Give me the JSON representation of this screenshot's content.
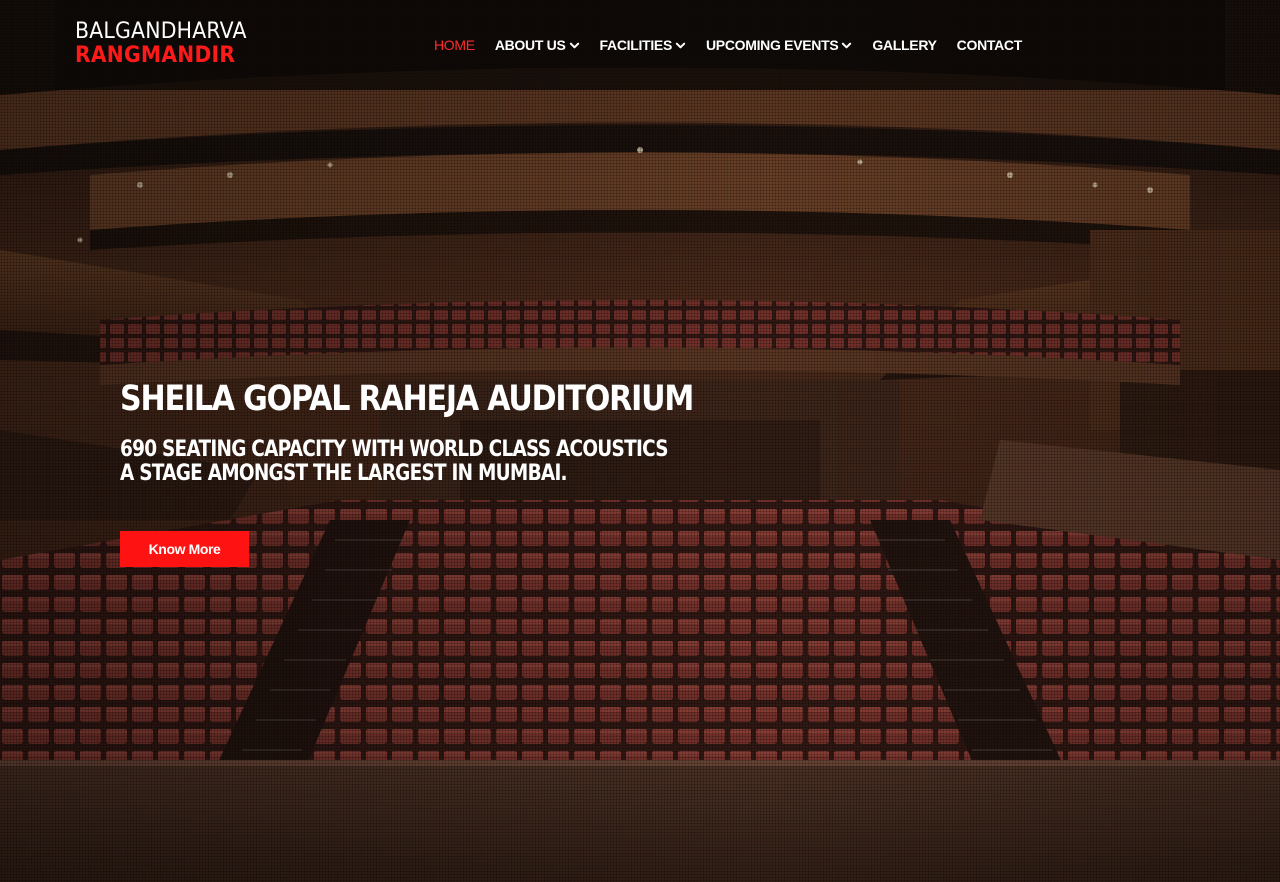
{
  "brand": {
    "name_top": "BALGANDHARVA",
    "name_bottom": "RANGMANDIR"
  },
  "nav": {
    "items": [
      {
        "label": "HOME",
        "active": true,
        "has_dropdown": false
      },
      {
        "label": "ABOUT US",
        "active": false,
        "has_dropdown": true
      },
      {
        "label": "FACILITIES",
        "active": false,
        "has_dropdown": true
      },
      {
        "label": "UPCOMING EVENTS",
        "active": false,
        "has_dropdown": true
      },
      {
        "label": "GALLERY",
        "active": false,
        "has_dropdown": false
      },
      {
        "label": "CONTACT",
        "active": false,
        "has_dropdown": false
      }
    ]
  },
  "hero": {
    "title": "SHEILA GOPAL RAHEJA AUDITORIUM",
    "subtitle_line1": "690 SEATING CAPACITY WITH WORLD CLASS ACOUSTICS",
    "subtitle_line2": "A STAGE AMONGST THE LARGEST IN MUMBAI.",
    "button_label": "Know More",
    "background": "auditorium-seating-image"
  },
  "colors": {
    "accent": "#ff1212",
    "nav_active": "#ff2b2b",
    "nav_bg": "#0c0806",
    "text": "#ffffff"
  }
}
